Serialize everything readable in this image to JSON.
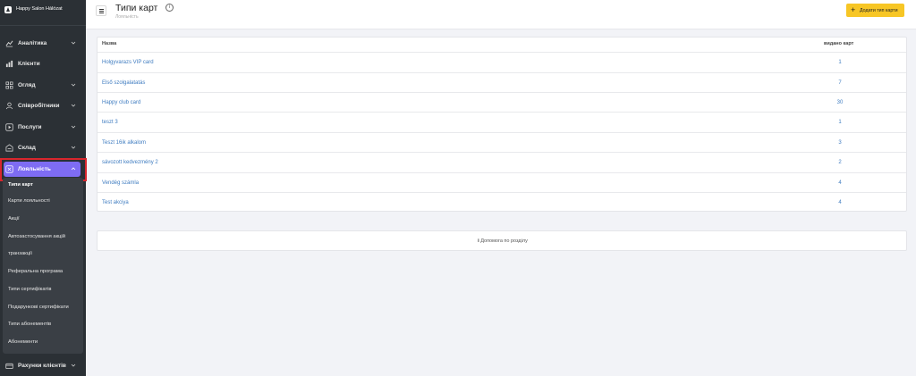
{
  "brand": {
    "name": "Happy Salon Hálózat"
  },
  "sidebar": {
    "items": [
      {
        "label": "Аналітика",
        "icon": "analytics-icon"
      },
      {
        "label": "Клієнти",
        "icon": "clients-icon"
      },
      {
        "label": "Огляд",
        "icon": "overview-icon"
      },
      {
        "label": "Співробітники",
        "icon": "user-icon"
      },
      {
        "label": "Послуги",
        "icon": "play-icon"
      },
      {
        "label": "Склад",
        "icon": "warehouse-icon"
      },
      {
        "label": "Лояльність",
        "icon": "loyalty-icon"
      },
      {
        "label": "Рахунки клієнтів",
        "icon": "wallet-icon"
      }
    ],
    "loyalty_sub": [
      "Типи карт",
      "Карти лояльності",
      "Акції",
      "Автозастосування акцій",
      "транзакції",
      "Реферальна програма",
      "Типи сертифікатів",
      "Подарункові сертифікати",
      "Типи абонементів",
      "Абонементи"
    ]
  },
  "header": {
    "title": "Типи карт",
    "subtitle": "Лояльність",
    "add_button": "Додати тип карти"
  },
  "table": {
    "columns": [
      "Назва",
      "видано карт"
    ],
    "rows": [
      {
        "name": "Holgyvarazs VIP card",
        "count": "1"
      },
      {
        "name": "Első szolgalatatás",
        "count": "7"
      },
      {
        "name": "Happy club card",
        "count": "30"
      },
      {
        "name": "teszt 3",
        "count": "1"
      },
      {
        "name": "Teszt 16ik alkalom",
        "count": "3"
      },
      {
        "name": "sávozott kedvezmény 2",
        "count": "2"
      },
      {
        "name": "Vendég számla",
        "count": "4"
      },
      {
        "name": "Test akciya",
        "count": "4"
      }
    ]
  },
  "help": {
    "icon_text": "i",
    "label": "Допомога по розділу"
  },
  "colors": {
    "sidebar_bg": "#2b3035",
    "active": "#7e6cf3",
    "accent": "#f7c625",
    "link": "#3f7cc0",
    "highlight": "#d9262d"
  }
}
